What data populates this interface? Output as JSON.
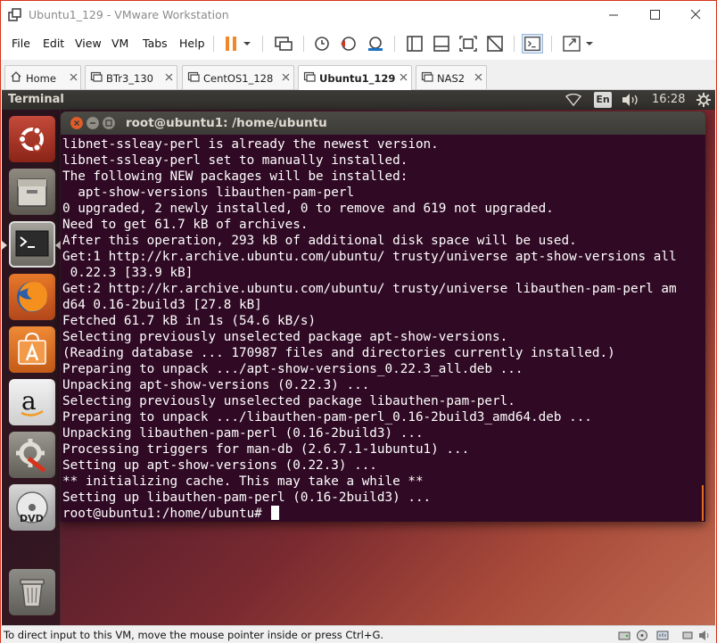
{
  "window": {
    "title": "Ubuntu1_129 - VMware Workstation"
  },
  "menubar": {
    "items": [
      "File",
      "Edit",
      "View",
      "VM",
      "Tabs",
      "Help"
    ]
  },
  "tabs": [
    {
      "label": "Home",
      "icon": "home-icon",
      "active": false
    },
    {
      "label": "BTr3_130",
      "icon": "vm-icon",
      "active": false
    },
    {
      "label": "CentOS1_128",
      "icon": "vm-icon",
      "active": false
    },
    {
      "label": "Ubuntu1_129",
      "icon": "vm-icon",
      "active": true
    },
    {
      "label": "NAS2",
      "icon": "vm-icon",
      "active": false
    }
  ],
  "guest_panel": {
    "app_title": "Terminal",
    "keyboard": "En",
    "clock": "16:28"
  },
  "launcher": {
    "items": [
      "ubuntu-dash-icon",
      "files-icon",
      "terminal-icon",
      "firefox-icon",
      "software-center-icon",
      "amazon-icon",
      "system-settings-icon",
      "dvd-icon",
      "trash-icon"
    ]
  },
  "terminal": {
    "title": "root@ubuntu1: /home/ubuntu",
    "lines": [
      "libnet-ssleay-perl is already the newest version.",
      "libnet-ssleay-perl set to manually installed.",
      "The following NEW packages will be installed:",
      "  apt-show-versions libauthen-pam-perl",
      "0 upgraded, 2 newly installed, 0 to remove and 619 not upgraded.",
      "Need to get 61.7 kB of archives.",
      "After this operation, 293 kB of additional disk space will be used.",
      "Get:1 http://kr.archive.ubuntu.com/ubuntu/ trusty/universe apt-show-versions all",
      " 0.22.3 [33.9 kB]",
      "Get:2 http://kr.archive.ubuntu.com/ubuntu/ trusty/universe libauthen-pam-perl am",
      "d64 0.16-2build3 [27.8 kB]",
      "Fetched 61.7 kB in 1s (54.6 kB/s)",
      "Selecting previously unselected package apt-show-versions.",
      "(Reading database ... 170987 files and directories currently installed.)",
      "Preparing to unpack .../apt-show-versions_0.22.3_all.deb ...",
      "Unpacking apt-show-versions (0.22.3) ...",
      "Selecting previously unselected package libauthen-pam-perl.",
      "Preparing to unpack .../libauthen-pam-perl_0.16-2build3_amd64.deb ...",
      "Unpacking libauthen-pam-perl (0.16-2build3) ...",
      "Processing triggers for man-db (2.6.7.1-1ubuntu1) ...",
      "Setting up apt-show-versions (0.22.3) ...",
      "** initializing cache. This may take a while **",
      "Setting up libauthen-pam-perl (0.16-2build3) ..."
    ],
    "prompt": "root@ubuntu1:/home/ubuntu# "
  },
  "status_bar": {
    "text": "To direct input to this VM, move the mouse pointer inside or press Ctrl+G."
  },
  "colors": {
    "terminal_bg": "#300a24",
    "panel_bg": "#3c3b37",
    "pause_accent": "#f0882a",
    "window_border": "#d8321d"
  }
}
